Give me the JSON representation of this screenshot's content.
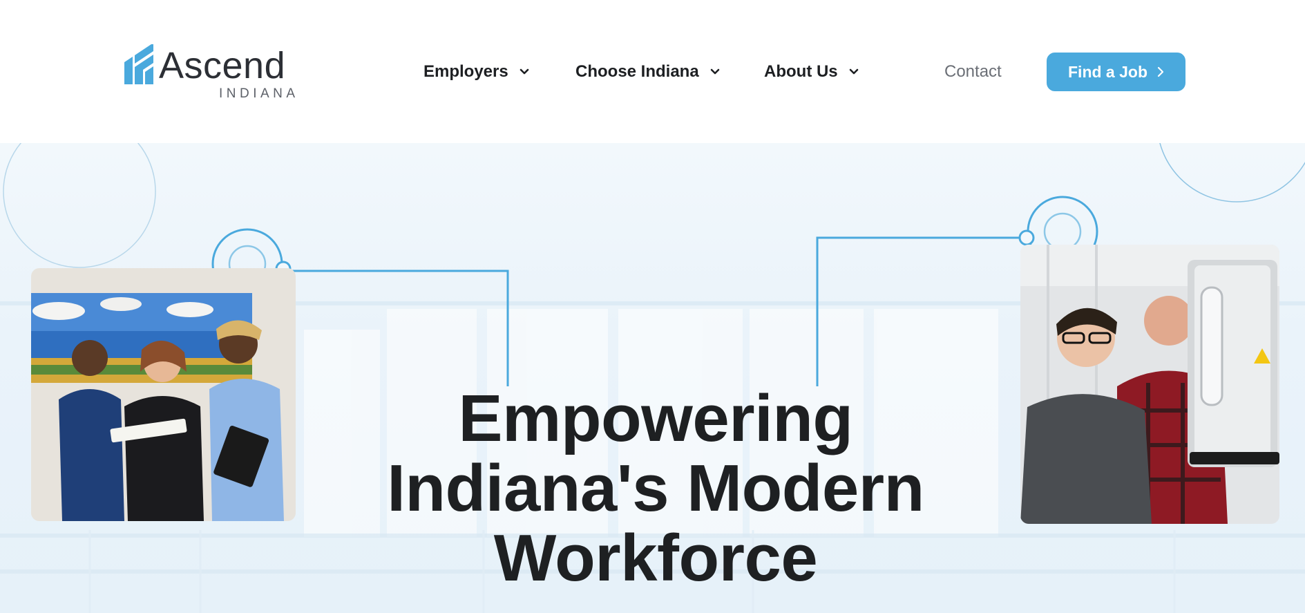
{
  "brand": {
    "name": "Ascend",
    "subname": "INDIANA",
    "accent_color": "#4aa9dd",
    "mark_icon": "ascend-stripes-logo"
  },
  "nav": {
    "items": [
      {
        "label": "Employers",
        "icon": "chevron-down-icon"
      },
      {
        "label": "Choose Indiana",
        "icon": "chevron-down-icon"
      },
      {
        "label": "About Us",
        "icon": "chevron-down-icon"
      }
    ],
    "contact": "Contact",
    "cta": {
      "label": "Find a Job",
      "icon": "chevron-right-icon"
    }
  },
  "hero": {
    "headline_lines": [
      "Empowering",
      "Indiana's Modern",
      "Workforce"
    ],
    "line_color": "#4aa9dd",
    "images": [
      {
        "name": "healthcare-workers-photo",
        "description_icon": "photo"
      },
      {
        "name": "manufacturing-workers-photo",
        "description_icon": "photo"
      }
    ]
  }
}
